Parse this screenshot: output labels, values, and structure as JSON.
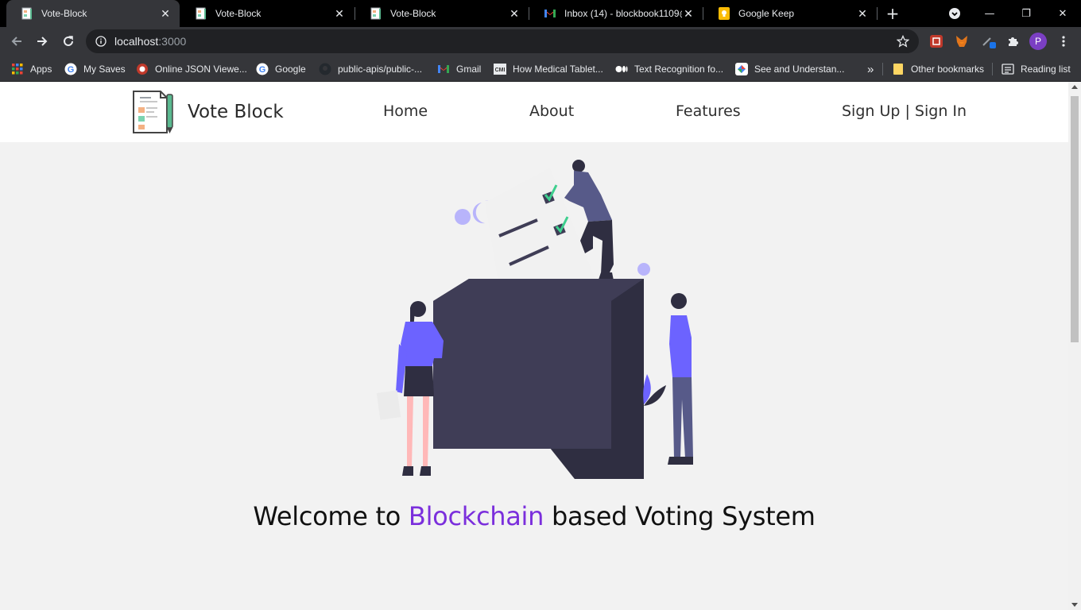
{
  "browser": {
    "tabs": [
      {
        "title": "Vote-Block",
        "active": true
      },
      {
        "title": "Vote-Block",
        "active": false
      },
      {
        "title": "Vote-Block",
        "active": false
      },
      {
        "title": "Inbox (14) - blockbook1109@",
        "active": false
      },
      {
        "title": "Google Keep",
        "active": false
      }
    ],
    "close_glyph": "✕",
    "new_tab_glyph": "+",
    "window_controls": {
      "minimize": "—",
      "restore": "❐",
      "close": "✕"
    },
    "url": {
      "host": "localhost",
      "port": ":3000"
    },
    "profile_initial": "P"
  },
  "bookmarks": [
    {
      "label": "Apps",
      "icon": "apps-grid-icon"
    },
    {
      "label": "My Saves",
      "icon": "google-icon"
    },
    {
      "label": "Online JSON Viewe...",
      "icon": "json-viewer-icon"
    },
    {
      "label": "Google",
      "icon": "google-icon"
    },
    {
      "label": "public-apis/public-...",
      "icon": "github-icon"
    },
    {
      "label": "Gmail",
      "icon": "gmail-icon"
    },
    {
      "label": "How Medical Tablet...",
      "icon": "cmi-icon"
    },
    {
      "label": "Text Recognition fo...",
      "icon": "medium-icon"
    },
    {
      "label": "See and Understan...",
      "icon": "google-lens-icon"
    }
  ],
  "bookmarks_overflow": "»",
  "other_bookmarks": "Other bookmarks",
  "reading_list": "Reading list",
  "site": {
    "brand": "Vote Block",
    "nav": {
      "home": "Home",
      "about": "About",
      "features": "Features",
      "auth": "Sign Up | Sign In"
    },
    "welcome": {
      "prefix": "Welcome to ",
      "highlight": "Blockchain",
      "suffix": " based Voting System"
    }
  },
  "colors": {
    "accent": "#7b2fdc",
    "illustration_purple": "#6c63ff",
    "ballot_box": "#3f3d56",
    "tab_active": "#35363a",
    "page_background": "#f2f2f2"
  }
}
